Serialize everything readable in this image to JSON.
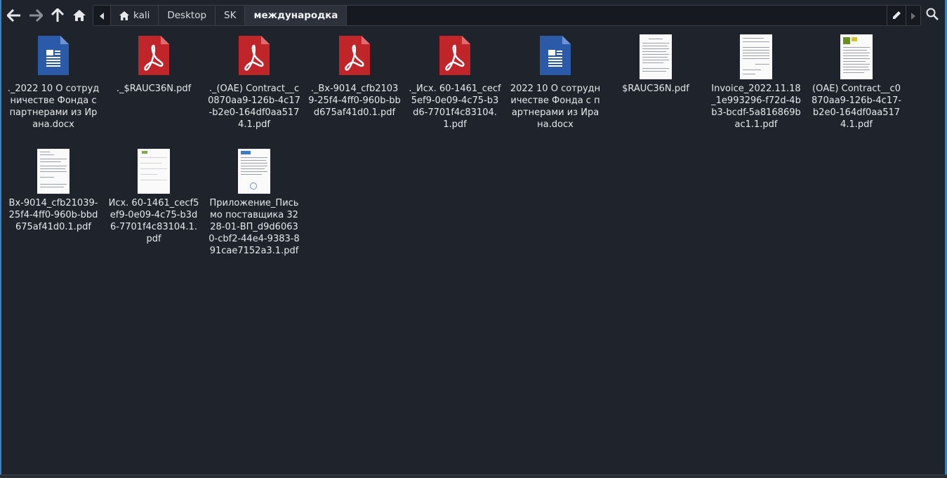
{
  "toolbar": {
    "back": "back-icon",
    "forward": "forward-icon",
    "up": "up-icon",
    "home": "home-icon"
  },
  "pathbar": {
    "crumbs": [
      "kali",
      "Desktop",
      "SK",
      "международка"
    ]
  },
  "files": [
    {
      "label": "._2022 10 О сотрудничестве Фонда с партнерами из Ирана.docx",
      "icon": "word-doc-icon"
    },
    {
      "label": "._$RAUC36N.pdf",
      "icon": "pdf-icon"
    },
    {
      "label": "._(ОАЕ) Contract__c0870aa9-126b-4c17-b2e0-164df0aa5174.1.pdf",
      "icon": "pdf-icon"
    },
    {
      "label": "._Вх-9014_cfb21039-25f4-4ff0-960b-bbd675af41d0.1.pdf",
      "icon": "pdf-icon"
    },
    {
      "label": "._Исх. 60-1461_cecf5ef9-0e09-4c75-b3d6-7701f4c83104.1.pdf",
      "icon": "pdf-icon"
    },
    {
      "label": "2022 10 О сотрудничестве Фонда с партнерами из Ирана.docx",
      "icon": "word-doc-icon"
    },
    {
      "label": "$RAUC36N.pdf",
      "icon": "pdf-thumbnail"
    },
    {
      "label": "Invoice_2022.11.18_1e993296-f72d-4bb3-bcdf-5a816869bac1.1.pdf",
      "icon": "pdf-thumbnail"
    },
    {
      "label": "(ОАЕ) Contract__c0870aa9-126b-4c17-b2e0-164df0aa5174.1.pdf",
      "icon": "pdf-thumbnail"
    },
    {
      "label": "Вх-9014_cfb21039-25f4-4ff0-960b-bbd675af41d0.1.pdf",
      "icon": "pdf-thumbnail"
    },
    {
      "label": "Исх. 60-1461_cecf5ef9-0e09-4c75-b3d6-7701f4c83104.1.pdf",
      "icon": "pdf-thumbnail"
    },
    {
      "label": "Приложение_Письмо поставщика 3228-01-ВП_d9d60630-cbf2-44e4-9383-891cae7152a3.1.pdf",
      "icon": "pdf-thumbnail"
    }
  ],
  "colors": {
    "background": "#1f232c",
    "accent": "#3b82c4",
    "pdf_red": "#c0252a",
    "word_blue": "#2b5aa8"
  }
}
